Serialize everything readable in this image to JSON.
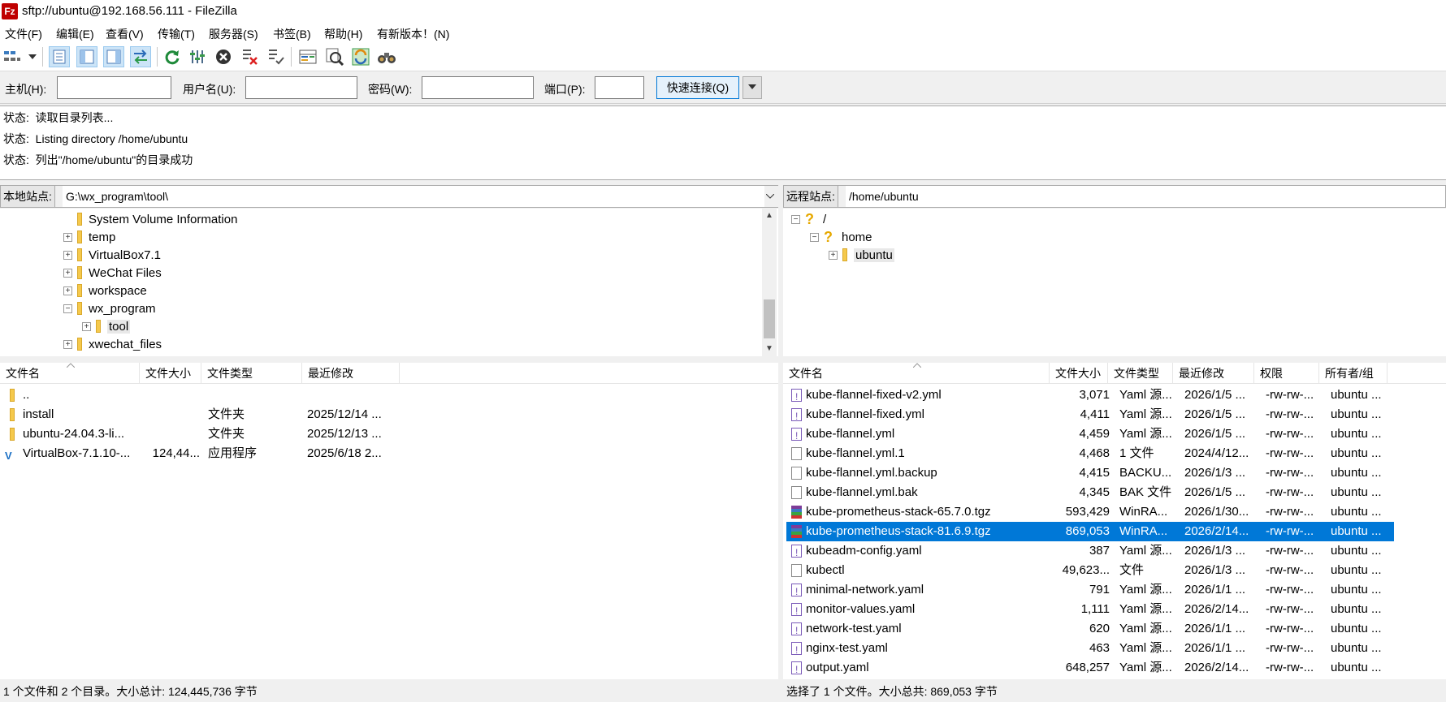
{
  "title": "sftp://ubuntu@192.168.56.111 - FileZilla",
  "app_icon_text": "Fz",
  "menu": [
    "文件(F)",
    "编辑(E)",
    "查看(V)",
    "传输(T)",
    "服务器(S)",
    "书签(B)",
    "帮助(H)",
    "有新版本！(N)"
  ],
  "quickconnect": {
    "host_label": "主机(H):",
    "user_label": "用户名(U):",
    "pass_label": "密码(W):",
    "port_label": "端口(P):",
    "host": "",
    "user": "",
    "pass": "",
    "port": "",
    "button": "快速连接(Q)"
  },
  "log": [
    {
      "prefix": "状态:",
      "text": "读取目录列表..."
    },
    {
      "prefix": "状态:",
      "text": "Listing directory /home/ubuntu"
    },
    {
      "prefix": "状态:",
      "text": "列出\"/home/ubuntu\"的目录成功"
    }
  ],
  "local": {
    "site_label": "本地站点:",
    "path": "G:\\wx_program\\tool\\",
    "tree": [
      "System Volume Information",
      "temp",
      "VirtualBox7.1",
      "WeChat Files",
      "workspace",
      "wx_program",
      "tool",
      "xwechat_files"
    ],
    "headers": [
      "文件名",
      "文件大小",
      "文件类型",
      "最近修改"
    ],
    "files": [
      {
        "name": "..",
        "size": "",
        "type": "",
        "modified": ""
      },
      {
        "name": "install",
        "size": "",
        "type": "文件夹",
        "modified": "2025/12/14 ..."
      },
      {
        "name": "ubuntu-24.04.3-li...",
        "size": "",
        "type": "文件夹",
        "modified": "2025/12/13 ..."
      },
      {
        "name": "VirtualBox-7.1.10-...",
        "size": "124,44...",
        "type": "应用程序",
        "modified": "2025/6/18 2..."
      }
    ],
    "status": "1 个文件和 2 个目录。大小总计: 124,445,736 字节"
  },
  "remote": {
    "site_label": "远程站点:",
    "path": "/home/ubuntu",
    "tree": [
      "/",
      "home",
      "ubuntu"
    ],
    "headers": [
      "文件名",
      "文件大小",
      "文件类型",
      "最近修改",
      "权限",
      "所有者/组"
    ],
    "files": [
      {
        "name": "kube-flannel-fixed-v2.yml",
        "size": "3,071",
        "type": "Yaml 源...",
        "modified": "2026/1/5 ...",
        "perm": "-rw-rw-...",
        "owner": "ubuntu ...",
        "icon": "yaml"
      },
      {
        "name": "kube-flannel-fixed.yml",
        "size": "4,411",
        "type": "Yaml 源...",
        "modified": "2026/1/5 ...",
        "perm": "-rw-rw-...",
        "owner": "ubuntu ...",
        "icon": "yaml"
      },
      {
        "name": "kube-flannel.yml",
        "size": "4,459",
        "type": "Yaml 源...",
        "modified": "2026/1/5 ...",
        "perm": "-rw-rw-...",
        "owner": "ubuntu ...",
        "icon": "yaml"
      },
      {
        "name": "kube-flannel.yml.1",
        "size": "4,468",
        "type": "1 文件",
        "modified": "2024/4/12...",
        "perm": "-rw-rw-...",
        "owner": "ubuntu ...",
        "icon": "file"
      },
      {
        "name": "kube-flannel.yml.backup",
        "size": "4,415",
        "type": "BACKU...",
        "modified": "2026/1/3 ...",
        "perm": "-rw-rw-...",
        "owner": "ubuntu ...",
        "icon": "file"
      },
      {
        "name": "kube-flannel.yml.bak",
        "size": "4,345",
        "type": "BAK 文件",
        "modified": "2026/1/5 ...",
        "perm": "-rw-rw-...",
        "owner": "ubuntu ...",
        "icon": "file"
      },
      {
        "name": "kube-prometheus-stack-65.7.0.tgz",
        "size": "593,429",
        "type": "WinRA...",
        "modified": "2026/1/30...",
        "perm": "-rw-rw-...",
        "owner": "ubuntu ...",
        "icon": "rar"
      },
      {
        "name": "kube-prometheus-stack-81.6.9.tgz",
        "size": "869,053",
        "type": "WinRA...",
        "modified": "2026/2/14...",
        "perm": "-rw-rw-...",
        "owner": "ubuntu ...",
        "icon": "rar",
        "selected": true
      },
      {
        "name": "kubeadm-config.yaml",
        "size": "387",
        "type": "Yaml 源...",
        "modified": "2026/1/3 ...",
        "perm": "-rw-rw-...",
        "owner": "ubuntu ...",
        "icon": "yaml"
      },
      {
        "name": "kubectl",
        "size": "49,623...",
        "type": "文件",
        "modified": "2026/1/3 ...",
        "perm": "-rw-rw-...",
        "owner": "ubuntu ...",
        "icon": "file"
      },
      {
        "name": "minimal-network.yaml",
        "size": "791",
        "type": "Yaml 源...",
        "modified": "2026/1/1 ...",
        "perm": "-rw-rw-...",
        "owner": "ubuntu ...",
        "icon": "yaml"
      },
      {
        "name": "monitor-values.yaml",
        "size": "1,111",
        "type": "Yaml 源...",
        "modified": "2026/2/14...",
        "perm": "-rw-rw-...",
        "owner": "ubuntu ...",
        "icon": "yaml"
      },
      {
        "name": "network-test.yaml",
        "size": "620",
        "type": "Yaml 源...",
        "modified": "2026/1/1 ...",
        "perm": "-rw-rw-...",
        "owner": "ubuntu ...",
        "icon": "yaml"
      },
      {
        "name": "nginx-test.yaml",
        "size": "463",
        "type": "Yaml 源...",
        "modified": "2026/1/1 ...",
        "perm": "-rw-rw-...",
        "owner": "ubuntu ...",
        "icon": "yaml"
      },
      {
        "name": "output.yaml",
        "size": "648,257",
        "type": "Yaml 源...",
        "modified": "2026/2/14...",
        "perm": "-rw-rw-...",
        "owner": "ubuntu ...",
        "icon": "yaml"
      }
    ],
    "status": "选择了 1 个文件。大小总共: 869,053 字节"
  },
  "colors": {
    "selection": "#0078d7",
    "folder": "#f5c94c",
    "accent": "#0078d7"
  }
}
